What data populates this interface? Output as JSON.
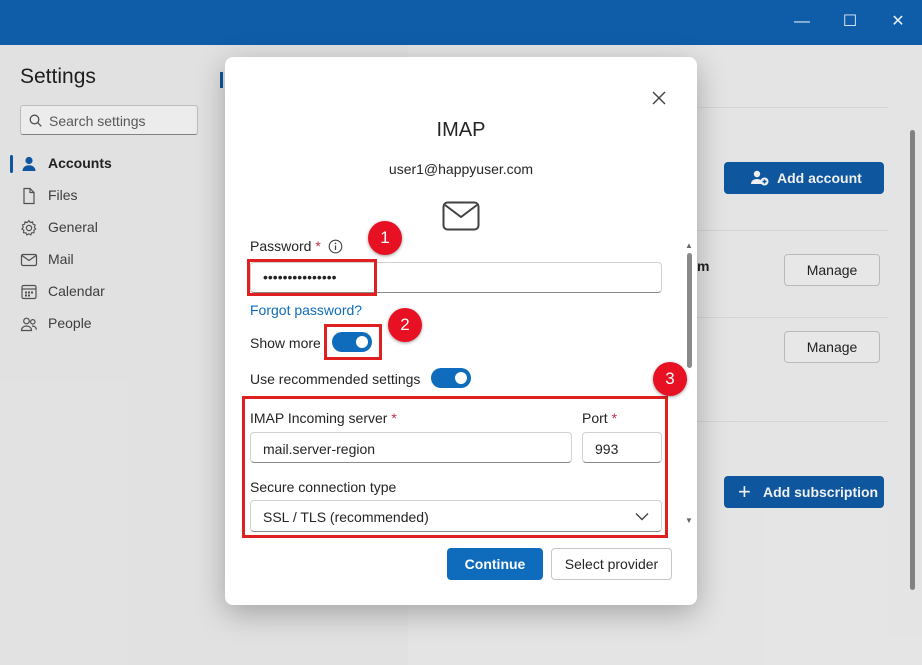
{
  "window": {
    "minimize": "—",
    "maximize": "☐",
    "close": "✕"
  },
  "settings": {
    "title": "Settings",
    "search_placeholder": "Search settings",
    "nav": [
      {
        "label": "Accounts",
        "icon": "person-icon",
        "active": true
      },
      {
        "label": "Files",
        "icon": "file-icon"
      },
      {
        "label": "General",
        "icon": "gear-icon"
      },
      {
        "label": "Mail",
        "icon": "mail-icon"
      },
      {
        "label": "Calendar",
        "icon": "calendar-icon"
      },
      {
        "label": "People",
        "icon": "people-icon"
      }
    ]
  },
  "background": {
    "add_account": "Add account",
    "partial_text": "m",
    "manage": "Manage",
    "add_subscription": "Add subscription"
  },
  "dialog": {
    "title": "IMAP",
    "email": "user1@happyuser.com",
    "password_label": "Password",
    "required_mark": "*",
    "password_value": "•••••••••••••••",
    "forgot_password": "Forgot password?",
    "show_more_label": "Show more",
    "show_more_on": true,
    "recommended_label": "Use recommended settings",
    "recommended_on": true,
    "incoming_server_label": "IMAP Incoming server",
    "incoming_server_value": "mail.server-region",
    "port_label": "Port",
    "port_value": "993",
    "secure_label": "Secure connection type",
    "secure_value": "SSL / TLS (recommended)",
    "continue": "Continue",
    "select_provider": "Select provider"
  },
  "callouts": [
    "1",
    "2",
    "3"
  ],
  "colors": {
    "accent": "#0f6cbd",
    "titlebar": "#0f5ca8",
    "callout": "#e02020"
  }
}
